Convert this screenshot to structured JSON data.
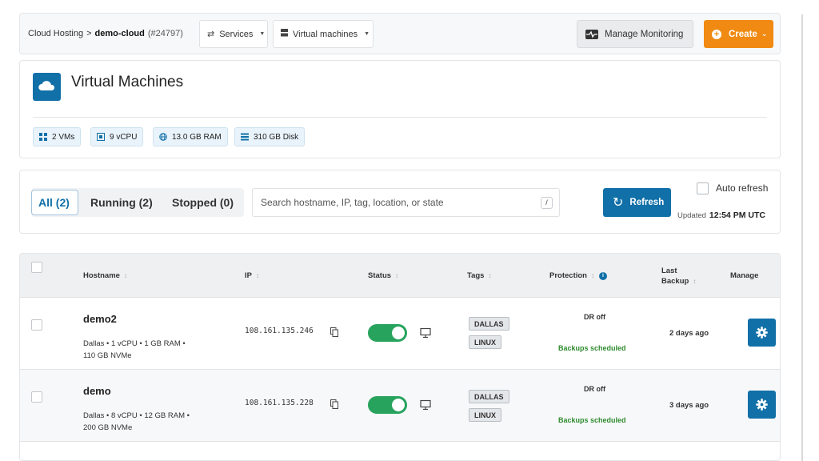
{
  "breadcrumb": {
    "root": "Cloud Hosting",
    "separator": ">",
    "project": "demo-cloud",
    "project_id": "(#24797)"
  },
  "nav": {
    "services_label": "Services",
    "vm_label": "Virtual machines",
    "manage_monitoring_label": "Manage Monitoring",
    "create_label": "Create"
  },
  "header": {
    "title": "Virtual Machines",
    "chips": {
      "vms": "2 VMs",
      "vcpu": "9 vCPU",
      "ram": "13.0 GB RAM",
      "disk": "310 GB Disk"
    }
  },
  "filters": {
    "tab_all": "All (2)",
    "tab_running": "Running (2)",
    "tab_stopped": "Stopped (0)",
    "search_placeholder": "Search hostname, IP, tag, location, or state",
    "search_shortcut": "/",
    "refresh_label": "Refresh",
    "auto_refresh_label": "Auto refresh",
    "updated_label": "Updated",
    "updated_time": "12:54 PM UTC"
  },
  "table": {
    "columns": {
      "hostname": "Hostname",
      "ip": "IP",
      "status": "Status",
      "tags": "Tags",
      "protection": "Protection",
      "last_backup_1": "Last",
      "last_backup_2": "Backup",
      "manage": "Manage"
    },
    "rows": [
      {
        "hostname": "demo2",
        "specs_1": "Dallas • 1 vCPU • 1 GB RAM •",
        "specs_2": "110 GB NVMe",
        "ip": "108.161.135.246",
        "running": true,
        "tags": [
          "DALLAS",
          "LINUX"
        ],
        "protection": "DR off",
        "backups": "Backups scheduled",
        "last_backup": "2 days ago"
      },
      {
        "hostname": "demo",
        "specs_1": "Dallas • 8 vCPU • 12 GB RAM •",
        "specs_2": "200 GB NVMe",
        "ip": "108.161.135.228",
        "running": true,
        "tags": [
          "DALLAS",
          "LINUX"
        ],
        "protection": "DR off",
        "backups": "Backups scheduled",
        "last_backup": "3 days ago"
      }
    ]
  },
  "colors": {
    "primary": "#1170a8",
    "accent": "#f08a12",
    "success": "#27a35d"
  }
}
